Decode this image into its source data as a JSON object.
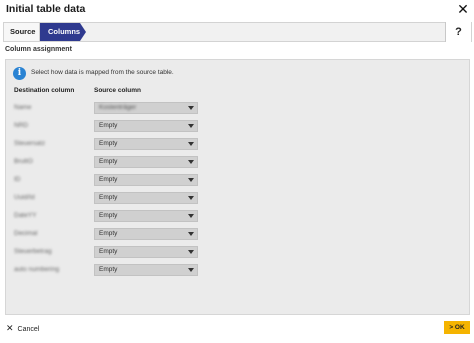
{
  "dialog": {
    "title": "Initial table data"
  },
  "steps": [
    {
      "label": "Source",
      "active": false
    },
    {
      "label": "Columns",
      "active": true
    }
  ],
  "help_label": "?",
  "section_label": "Column assignment",
  "info": {
    "icon": "info-icon",
    "text": "Select how data is mapped from the source table."
  },
  "table": {
    "headers": {
      "destination": "Destination column",
      "source": "Source column"
    },
    "rows": [
      {
        "destination": "Name",
        "source": "Kostenträger"
      },
      {
        "destination": "NRD",
        "source": "Empty"
      },
      {
        "destination": "Steuersatz",
        "source": "Empty"
      },
      {
        "destination": "BruttO",
        "source": "Empty"
      },
      {
        "destination": "ID",
        "source": "Empty"
      },
      {
        "destination": "Uuid/Id",
        "source": "Empty"
      },
      {
        "destination": "DateYY",
        "source": "Empty"
      },
      {
        "destination": "Decimal",
        "source": "Empty"
      },
      {
        "destination": "Steuerbetrag",
        "source": "Empty"
      },
      {
        "destination": "auto numbering",
        "source": "Empty"
      }
    ]
  },
  "footer": {
    "cancel_label": "Cancel",
    "ok_label": "> OK"
  },
  "colors": {
    "active_step": "#2f3a8f",
    "ok_button": "#f5b400",
    "info_icon": "#2a83d3"
  }
}
